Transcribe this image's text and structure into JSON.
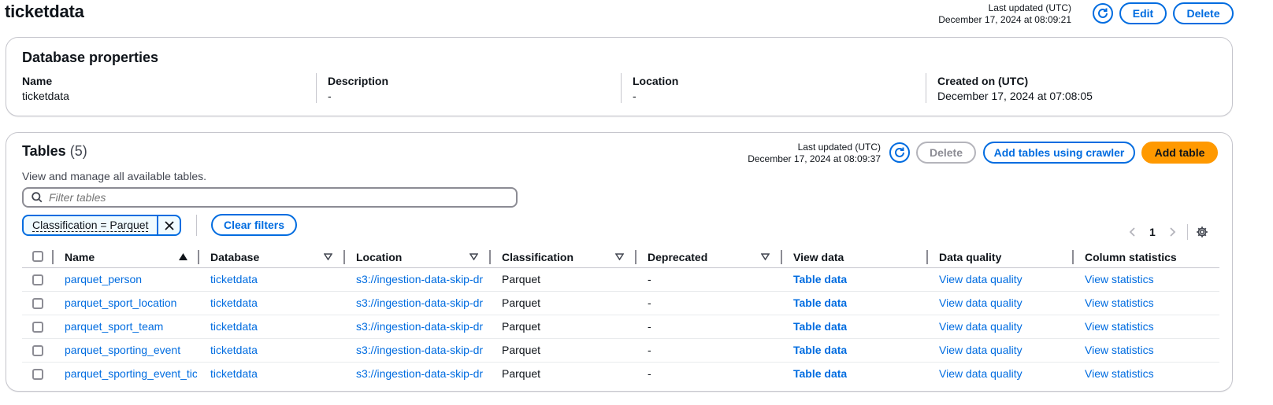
{
  "page": {
    "title": "ticketdata",
    "last_updated_label": "Last updated (UTC)",
    "last_updated_value": "December 17, 2024 at 08:09:21",
    "edit_label": "Edit",
    "delete_label": "Delete"
  },
  "database_properties": {
    "title": "Database properties",
    "fields": [
      {
        "label": "Name",
        "value": "ticketdata"
      },
      {
        "label": "Description",
        "value": "-"
      },
      {
        "label": "Location",
        "value": "-"
      },
      {
        "label": "Created on (UTC)",
        "value": "December 17, 2024 at 07:08:05"
      }
    ]
  },
  "tables": {
    "title": "Tables",
    "count": "(5)",
    "description": "View and manage all available tables.",
    "last_updated_label": "Last updated (UTC)",
    "last_updated_value": "December 17, 2024 at 08:09:37",
    "delete_label": "Delete",
    "add_crawler_label": "Add tables using crawler",
    "add_table_label": "Add table",
    "filter_placeholder": "Filter tables",
    "filter_token": "Classification = Parquet",
    "clear_filters_label": "Clear filters",
    "page_number": "1",
    "columns": [
      "Name",
      "Database",
      "Location",
      "Classification",
      "Deprecated",
      "View data",
      "Data quality",
      "Column statistics"
    ],
    "rows": [
      {
        "name": "parquet_person",
        "database": "ticketdata",
        "location": "s3://ingestion-data-skip-dr",
        "classification": "Parquet",
        "deprecated": "-",
        "view_data": "Table data",
        "data_quality": "View data quality",
        "column_statistics": "View statistics"
      },
      {
        "name": "parquet_sport_location",
        "database": "ticketdata",
        "location": "s3://ingestion-data-skip-dr",
        "classification": "Parquet",
        "deprecated": "-",
        "view_data": "Table data",
        "data_quality": "View data quality",
        "column_statistics": "View statistics"
      },
      {
        "name": "parquet_sport_team",
        "database": "ticketdata",
        "location": "s3://ingestion-data-skip-dr",
        "classification": "Parquet",
        "deprecated": "-",
        "view_data": "Table data",
        "data_quality": "View data quality",
        "column_statistics": "View statistics"
      },
      {
        "name": "parquet_sporting_event",
        "database": "ticketdata",
        "location": "s3://ingestion-data-skip-dr",
        "classification": "Parquet",
        "deprecated": "-",
        "view_data": "Table data",
        "data_quality": "View data quality",
        "column_statistics": "View statistics"
      },
      {
        "name": "parquet_sporting_event_tic",
        "database": "ticketdata",
        "location": "s3://ingestion-data-skip-dr",
        "classification": "Parquet",
        "deprecated": "-",
        "view_data": "Table data",
        "data_quality": "View data quality",
        "column_statistics": "View statistics"
      }
    ]
  },
  "colors": {
    "link": "#006ce0",
    "primary_button": "#ff9900",
    "border": "#c6c6cd"
  }
}
